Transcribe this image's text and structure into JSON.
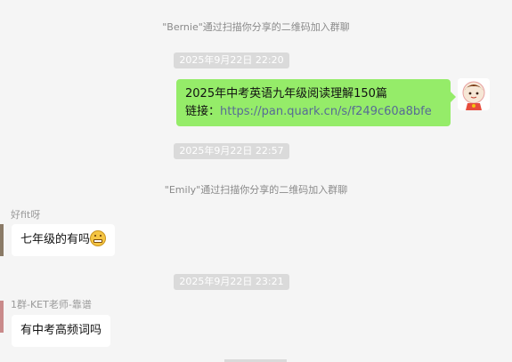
{
  "messages": {
    "sys1": "\"Bernie\"通过扫描你分享的二维码加入群聊",
    "time1": "2025年9月22日 22:20",
    "me_line1": "2025年中考英语九年级阅读理解150篇",
    "me_link_label": "链接：",
    "me_link_url": "https://pan.quark.cn/s/f249c60a8bfe",
    "time2": "2025年9月22日 22:57",
    "sys2": "\"Emily\"通过扫描你分享的二维码加入群聊",
    "name1": "好fit呀",
    "msg1": "七年级的有吗",
    "time3": "2025年9月22日 23:21",
    "name2": "1群-KET老师-靠谱",
    "msg2": "有中考高频词吗"
  },
  "colors": {
    "own_bubble": "#95ec69",
    "other_bubble": "#ffffff",
    "link": "#576b95",
    "background": "#f5f5f5"
  },
  "icons": {
    "msg1_emoji": "grinning-face-icon",
    "own_avatar": "cartoon-girl-avatar"
  }
}
